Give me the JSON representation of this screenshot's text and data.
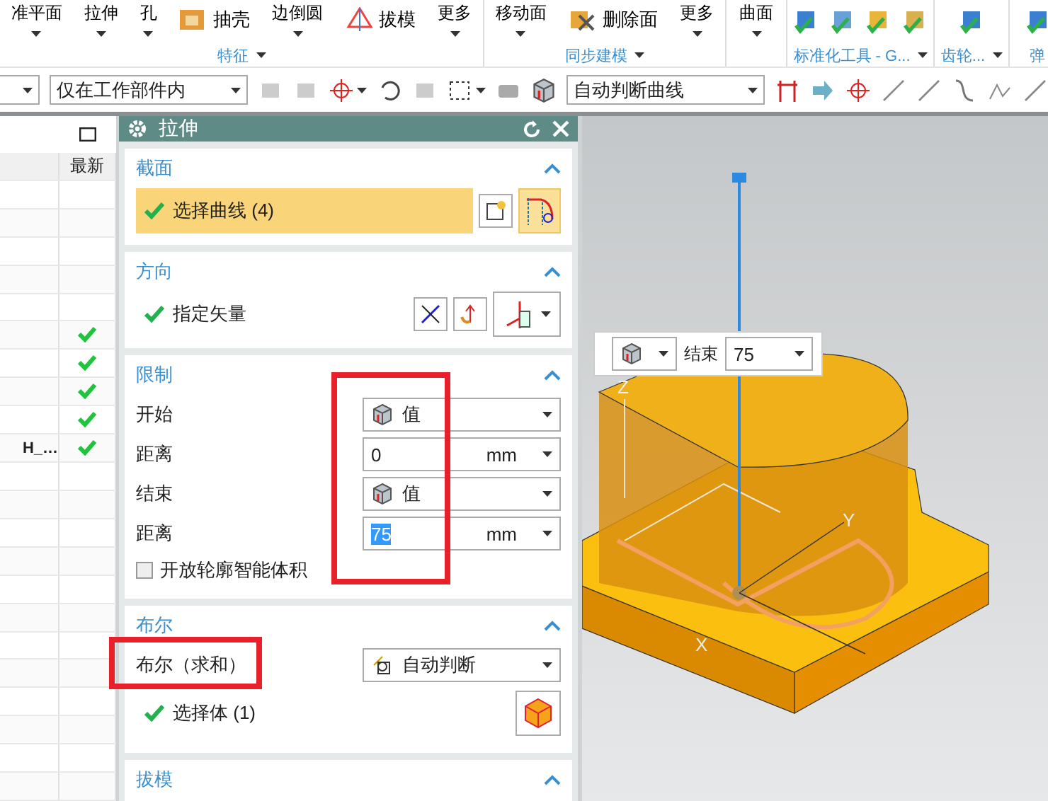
{
  "ribbon": {
    "groups": [
      {
        "label": "特征",
        "more": true,
        "items": [
          {
            "kind": "large",
            "text": "准平面"
          },
          {
            "kind": "large",
            "text": "拉伸"
          },
          {
            "kind": "large",
            "text": "孔"
          },
          {
            "kind": "small",
            "text": "抽壳"
          },
          {
            "kind": "large",
            "text": "边倒圆"
          },
          {
            "kind": "small",
            "text": "拔模"
          },
          {
            "kind": "large",
            "text": "更多"
          }
        ]
      },
      {
        "label": "同步建模",
        "more": true,
        "items": [
          {
            "kind": "large",
            "text": "移动面"
          },
          {
            "kind": "small",
            "text": "删除面"
          },
          {
            "kind": "large",
            "text": "更多"
          }
        ]
      },
      {
        "more": false,
        "items": [
          {
            "kind": "large",
            "text": "曲面"
          }
        ]
      },
      {
        "label": "标准化工具 - G...",
        "more": true,
        "items": [
          {
            "kind": "icon"
          },
          {
            "kind": "icon"
          },
          {
            "kind": "icon"
          },
          {
            "kind": "icon"
          }
        ]
      },
      {
        "label": "齿轮...",
        "more": true,
        "items": [
          {
            "kind": "icon"
          }
        ]
      },
      {
        "label": "弹",
        "more": false,
        "items": [
          {
            "kind": "icon"
          }
        ]
      }
    ]
  },
  "toolbar": {
    "filter_scope": "仅在工作部件内",
    "curve_rule": "自动判断曲线"
  },
  "navigator": {
    "columns": [
      "最新"
    ],
    "rows": [
      {
        "latest": false
      },
      {
        "latest": false
      },
      {
        "latest": false
      },
      {
        "latest": false
      },
      {
        "latest": false
      },
      {
        "latest": true
      },
      {
        "latest": true
      },
      {
        "latest": true
      },
      {
        "latest": true
      },
      {
        "text": "H_…",
        "latest": true
      },
      {
        "latest": false
      },
      {
        "latest": false
      },
      {
        "latest": false
      },
      {
        "latest": false
      },
      {
        "latest": false
      },
      {
        "latest": false
      },
      {
        "latest": false
      },
      {
        "latest": false
      },
      {
        "latest": false
      },
      {
        "latest": false
      },
      {
        "latest": false
      },
      {
        "latest": false
      }
    ]
  },
  "dialog": {
    "title": "拉伸",
    "sections": [
      {
        "kind": "selection",
        "title": "截面",
        "expanded": true,
        "label": "选择曲线 (4)",
        "done": true,
        "active": true
      },
      {
        "kind": "vector",
        "title": "方向",
        "expanded": true,
        "label": "指定矢量",
        "done": true
      },
      {
        "kind": "limits",
        "title": "限制",
        "expanded": true,
        "rows": [
          {
            "kind": "mode",
            "label": "开始",
            "value": "值"
          },
          {
            "kind": "distance",
            "label": "距离",
            "value": "0",
            "unit": "mm",
            "selected": false
          },
          {
            "kind": "mode",
            "label": "结束",
            "value": "值"
          },
          {
            "kind": "distance",
            "label": "距离",
            "value": "75",
            "unit": "mm",
            "selected": true
          }
        ],
        "checkbox": {
          "label": "开放轮廓智能体积",
          "checked": false
        }
      },
      {
        "kind": "boolean",
        "title": "布尔",
        "expanded": true,
        "label": "布尔（求和）",
        "value": "自动判断",
        "body_label": "选择体 (1)",
        "done": true
      },
      {
        "kind": "header",
        "title": "拔模",
        "expanded": true
      }
    ]
  },
  "viewport": {
    "floating": {
      "label": "结束",
      "value": "75"
    },
    "axis_labels": [
      "Z",
      "Y",
      "X"
    ]
  }
}
